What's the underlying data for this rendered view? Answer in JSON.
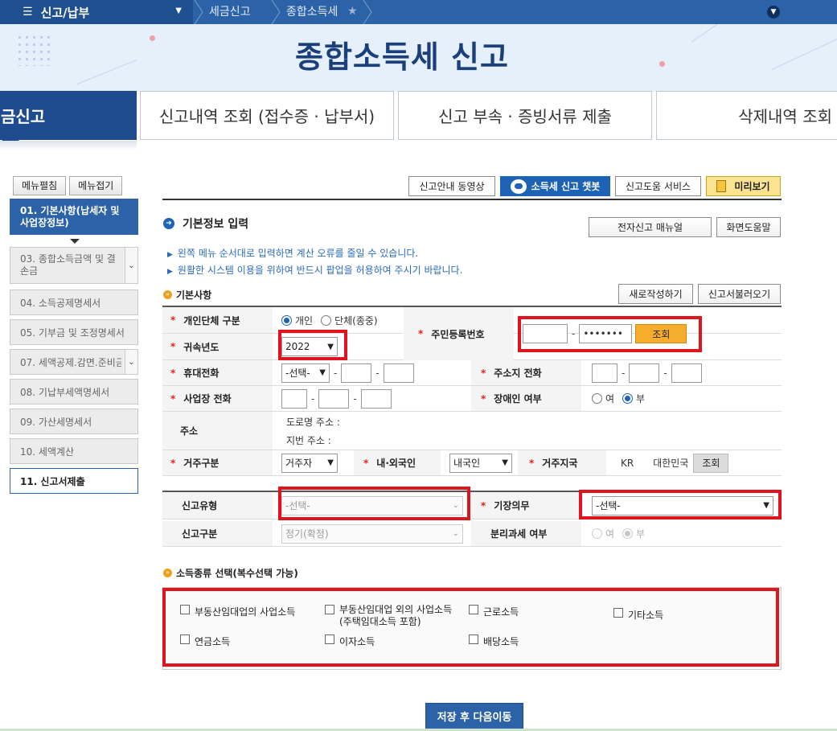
{
  "nav": {
    "menu_label": "신고/납부",
    "crumb1": "세금신고",
    "crumb2": "종합소득세"
  },
  "banner": {
    "title": "종합소득세 신고"
  },
  "tabs": [
    {
      "label": "금신고"
    },
    {
      "label": "신고내역 조회 (접수증 · 납부서)"
    },
    {
      "label": "신고 부속 · 증빙서류 제출"
    },
    {
      "label": "삭제내역 조회"
    }
  ],
  "sidebar": {
    "expand_label": "메뉴펼침",
    "collapse_label": "메뉴접기",
    "items": [
      {
        "label": "01. 기본사항(납세자 및 사업장정보)"
      },
      {
        "label": "03. 종합소득금액 및 결손금"
      },
      {
        "label": "04. 소득공제명세서"
      },
      {
        "label": "05. 기부금 및 조정명세서"
      },
      {
        "label": "07. 세액공제.감면.준비금"
      },
      {
        "label": "08. 기납부세액명세서"
      },
      {
        "label": "09. 가산세명세서"
      },
      {
        "label": "10. 세액계산"
      },
      {
        "label": "11. 신고서제출"
      }
    ]
  },
  "actions": {
    "guide_video": "신고안내 동영상",
    "chatbot": "소득세 신고 챗봇",
    "help_service": "신고도움 서비스",
    "preview": "미리보기"
  },
  "section": {
    "title": "기본정보 입력",
    "manual_btn": "전자신고 매뉴얼",
    "help_btn": "화면도움말",
    "notice1": "왼쪽 메뉴 순서대로 입력하면 계산 오류를 줄일 수 있습니다.",
    "notice2": "원활한 시스템 이용을 위하여 반드시 팝업을 허용하여 주시기 바랍니다."
  },
  "basic": {
    "title": "기본사항",
    "new_btn": "새로작성하기",
    "load_btn": "신고서불러오기",
    "person_type_label": "개인단체 구분",
    "person_opt": "개인",
    "group_opt": "단체(종중)",
    "rrn_label": "주민등록번호",
    "rrn_dash": "-",
    "rrn_back": "•••••••",
    "lookup_btn": "조회",
    "year_label": "귀속년도",
    "year_value": "2022",
    "mobile_label": "휴대전화",
    "mobile_select": "-선택-",
    "home_phone_label": "주소지 전화",
    "biz_phone_label": "사업장 전화",
    "disabled_label": "장애인 여부",
    "yes": "여",
    "no": "부",
    "address_label": "주소",
    "road_addr": "도로명 주소 :",
    "lot_addr": "지번 주소 :",
    "resident_label": "거주구분",
    "resident_value": "거주자",
    "nation_type_label": "내·외국인",
    "nation_type_value": "내국인",
    "country_label": "거주지국",
    "country_code": "KR",
    "country_name": "대한민국",
    "country_btn": "조회"
  },
  "filing": {
    "type_label": "신고유형",
    "type_value": "-선택-",
    "book_label": "기장의무",
    "book_value": "-선택-",
    "kind_label": "신고구분",
    "kind_value": "정기(확정)",
    "sep_tax_label": "분리과세 여부",
    "yes": "여",
    "no": "부"
  },
  "income": {
    "title": "소득종류 선택(복수선택 가능)",
    "items": [
      {
        "label": "부동산임대업의 사업소득"
      },
      {
        "label": "부동산임대업 외의 사업소득",
        "sub": "(주택임대소득 포함)"
      },
      {
        "label": "근로소득"
      },
      {
        "label": "기타소득"
      },
      {
        "label": "연금소득"
      },
      {
        "label": "이자소득"
      },
      {
        "label": "배당소득"
      }
    ]
  },
  "footer": {
    "save_btn": "저장 후 다음이동"
  }
}
